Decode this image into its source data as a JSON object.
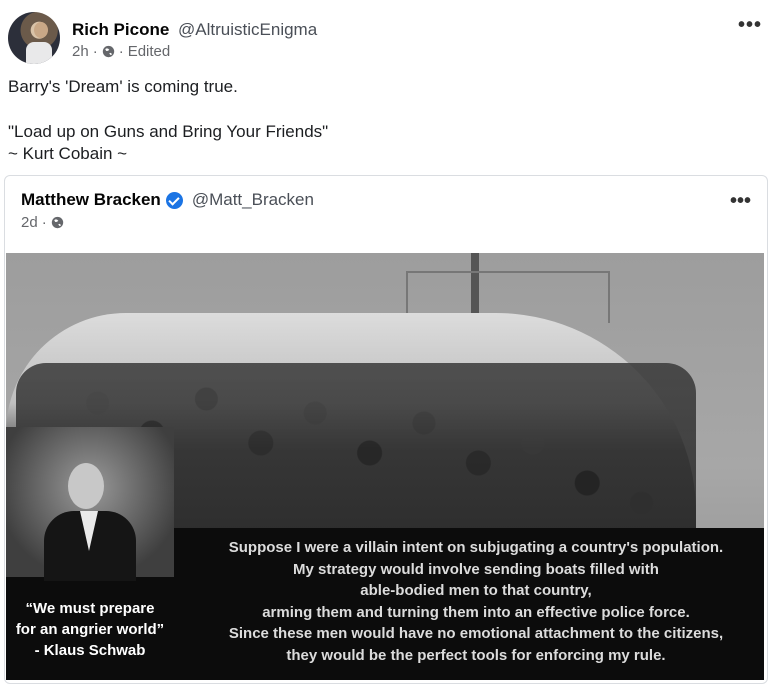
{
  "post": {
    "author_name": "Rich Picone",
    "handle": "@AltruisticEnigma",
    "time": "2h",
    "edited": "Edited",
    "text_lines": [
      "Barry's 'Dream' is coming true."
    ],
    "quote_lines": [
      "\"Load up on Guns and Bring Your Friends\"",
      "~ Kurt Cobain ~"
    ],
    "more_icon": "more-horizontal-icon"
  },
  "shared": {
    "author_name": "Matthew Bracken",
    "handle": "@Matt_Bracken",
    "time": "2d",
    "verified_color": "#1b74e4",
    "meme": {
      "left_quote": [
        "“We must prepare",
        "for an angrier world”",
        "- Klaus Schwab"
      ],
      "right_quote": [
        "Suppose I were a villain intent on subjugating a country's population.",
        "My strategy would involve sending boats filled with",
        "able-bodied men to that country,",
        "arming them and turning them into an effective police force.",
        "Since these men would have no emotional attachment to the citizens,",
        "they would be the perfect tools for enforcing my rule."
      ]
    }
  },
  "separators": {
    "dot": "·",
    "ellipsis": "•••"
  }
}
